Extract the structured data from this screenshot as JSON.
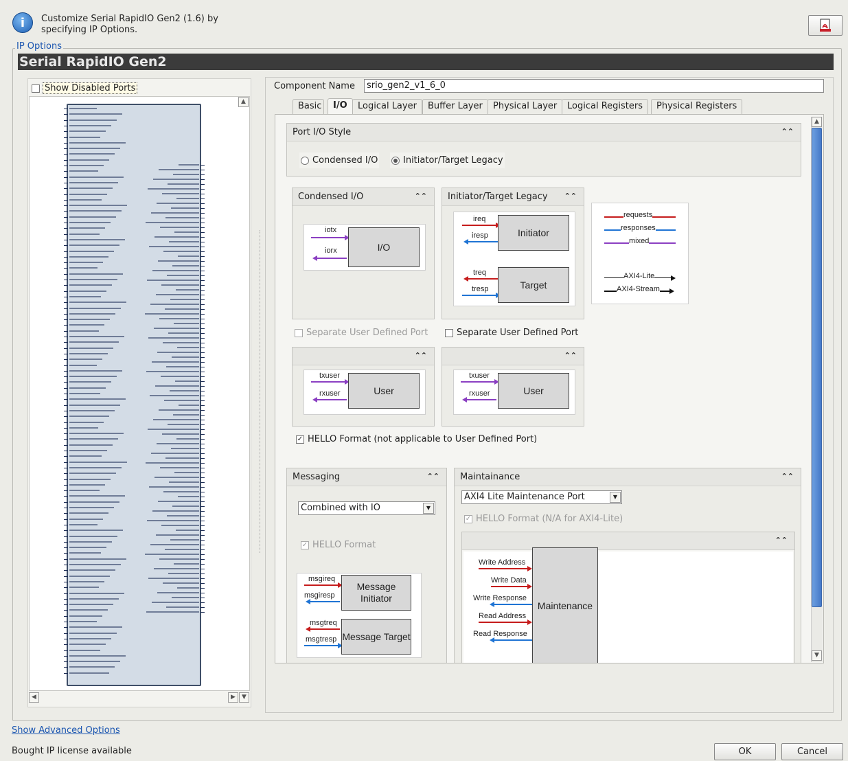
{
  "header": {
    "line1": "Customize Serial RapidIO Gen2 (1.6) by",
    "line2": "specifying IP Options.",
    "info_icon": "info-icon",
    "doc_icon": "pdf-doc-icon"
  },
  "ip_options_label": "IP Options",
  "title": "Serial RapidIO Gen2",
  "left": {
    "show_disabled_ports": "Show Disabled Ports"
  },
  "component": {
    "label": "Component Name",
    "value": "srio_gen2_v1_6_0"
  },
  "tabs": [
    "Basic",
    "I/O",
    "Logical Layer",
    "Buffer Layer",
    "Physical Layer",
    "Logical Registers",
    "Physical Registers"
  ],
  "active_tab": "I/O",
  "port_io_style": {
    "title": "Port I/O Style",
    "opt_condensed": "Condensed I/O",
    "opt_legacy": "Initiator/Target Legacy",
    "selected": "Initiator/Target Legacy"
  },
  "condensed_panel": {
    "title": "Condensed I/O",
    "iotx": "iotx",
    "iorx": "iorx",
    "box": "I/O"
  },
  "legacy_panel": {
    "title": "Initiator/Target Legacy",
    "ireq": "ireq",
    "iresp": "iresp",
    "initiator": "Initiator",
    "treq": "treq",
    "tresp": "tresp",
    "target": "Target"
  },
  "legend": {
    "requests": "requests",
    "responses": "responses",
    "mixed": "mixed",
    "axi4_lite": "AXI4-Lite",
    "axi4_stream": "AXI4-Stream"
  },
  "user_ports": {
    "left_label": "Separate User Defined Port",
    "right_label": "Separate User Defined Port",
    "txuser": "txuser",
    "rxuser": "rxuser",
    "box": "User"
  },
  "hello": {
    "label": "HELLO Format (not applicable to User Defined Port)",
    "checked": true
  },
  "messaging": {
    "title": "Messaging",
    "select": "Combined with IO",
    "hello": "HELLO Format",
    "msgireq": "msgireq",
    "msgiresp": "msgiresp",
    "msg_initiator": "Message Initiator",
    "msgtreq": "msgtreq",
    "msgtresp": "msgtresp",
    "msg_target": "Message Target"
  },
  "maintenance": {
    "title": "Maintainance",
    "select": "AXI4 Lite Maintenance Port",
    "hello": "HELLO Format (N/A for AXI4-Lite)",
    "write_address": "Write Address",
    "write_data": "Write Data",
    "write_response": "Write Response",
    "read_address": "Read Address",
    "read_response": "Read Response",
    "box": "Maintenance"
  },
  "footer": {
    "advanced": "Show Advanced Options",
    "license": "Bought IP license available",
    "ok": "OK",
    "cancel": "Cancel"
  },
  "colors": {
    "requests": "#c61c1c",
    "responses": "#1f74d4",
    "mixed": "#8b3fc2",
    "title_bar": "#3b3b3b",
    "scroll_thumb": "#4579c8"
  }
}
